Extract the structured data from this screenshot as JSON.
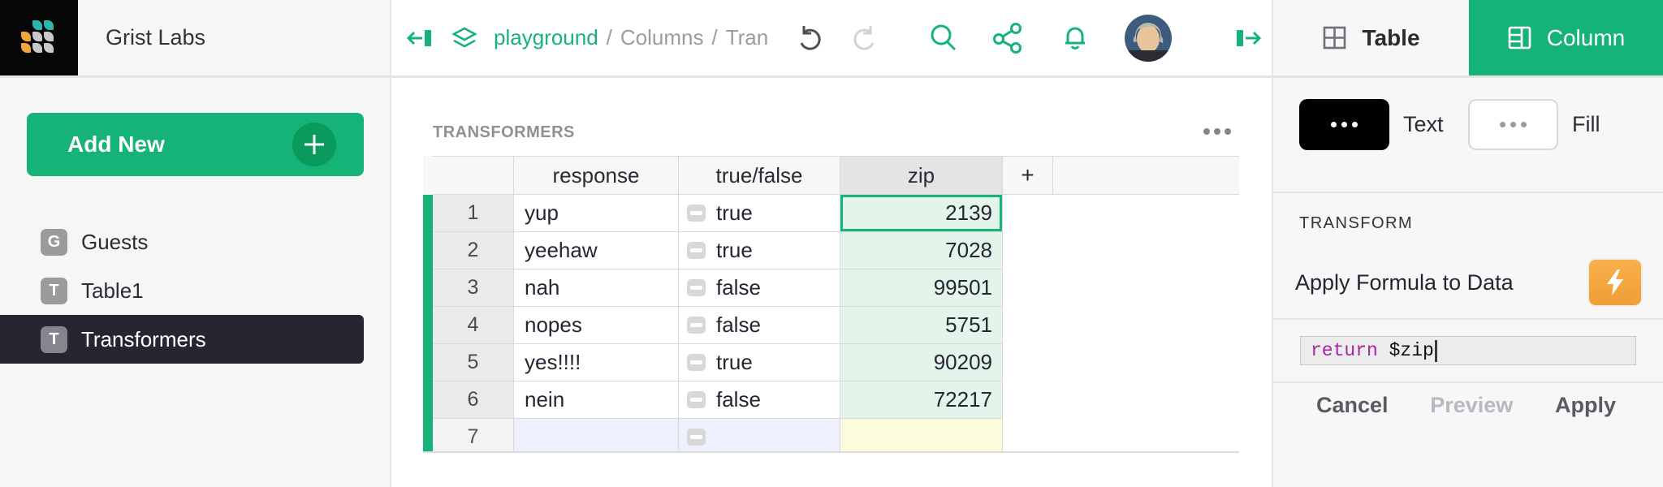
{
  "topbar": {
    "workspace": "Grist Labs",
    "breadcrumb": {
      "doc": "playground",
      "sep1": "/",
      "page": "Columns",
      "sep2": "/",
      "truncated": "Tran"
    }
  },
  "sidebar": {
    "add_new_label": "Add New",
    "items": [
      {
        "initial": "G",
        "label": "Guests"
      },
      {
        "initial": "T",
        "label": "Table1"
      },
      {
        "initial": "T",
        "label": "Transformers"
      }
    ]
  },
  "main": {
    "widget_title": "TRANSFORMERS"
  },
  "table": {
    "columns": [
      "response",
      "true/false",
      "zip",
      "+"
    ],
    "rows": [
      {
        "num": "1",
        "response": "yup",
        "bool": "true",
        "zip": "2139"
      },
      {
        "num": "2",
        "response": "yeehaw",
        "bool": "true",
        "zip": "7028"
      },
      {
        "num": "3",
        "response": "nah",
        "bool": "false",
        "zip": "99501"
      },
      {
        "num": "4",
        "response": "nopes",
        "bool": "false",
        "zip": "5751"
      },
      {
        "num": "5",
        "response": "yes!!!!",
        "bool": "true",
        "zip": "90209"
      },
      {
        "num": "6",
        "response": "nein",
        "bool": "false",
        "zip": "72217"
      },
      {
        "num": "7",
        "response": "",
        "bool": "",
        "zip": ""
      }
    ],
    "selected_cell": "row 1, zip"
  },
  "right_panel": {
    "tabs": [
      {
        "label": "Table"
      },
      {
        "label": "Column"
      }
    ],
    "style": {
      "text_label": "Text",
      "fill_label": "Fill"
    },
    "transform": {
      "section_label": "TRANSFORM",
      "action_label": "Apply Formula to Data",
      "formula_keyword": "return",
      "formula_rest": " $zip",
      "cancel_label": "Cancel",
      "preview_label": "Preview",
      "apply_label": "Apply"
    }
  },
  "colors": {
    "accent_green": "#16b378",
    "dark_green": "#0a9a5c",
    "selection_mint": "#e3f5eb",
    "add_row_lavender": "#eef0fd",
    "add_row_yellow": "#fbfbde",
    "dark_slate": "#262633",
    "orange_action": "#f0a43e",
    "formula_keyword_purple": "#a626a4",
    "logo_teal": "#2cb5ac",
    "logo_orange": "#f0a43e"
  }
}
